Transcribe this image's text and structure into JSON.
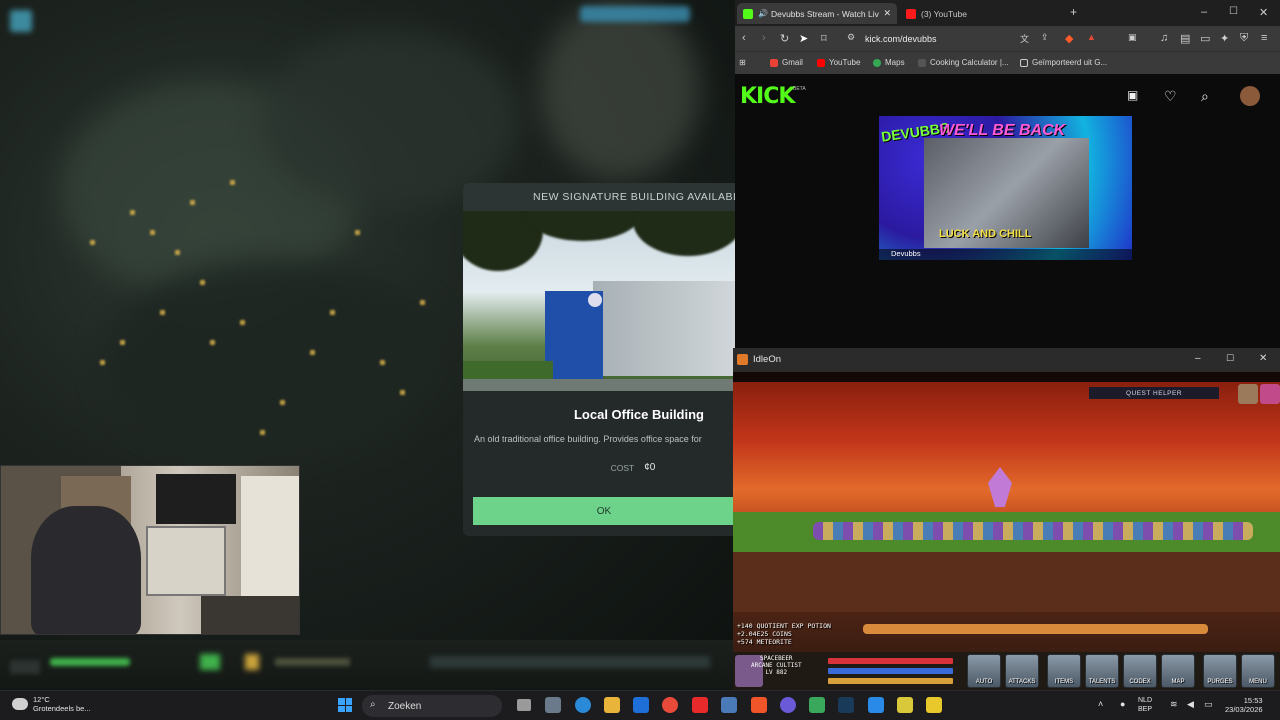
{
  "game_modal": {
    "header": "NEW SIGNATURE BUILDING AVAILABL",
    "title": "Local Office Building",
    "description": "An old traditional office building. Provides office space for",
    "cost_label": "COST",
    "cost_value": "¢0",
    "ok_label": "OK"
  },
  "browser": {
    "tabs": [
      {
        "label": "Devubbs Stream - Watch Live",
        "close": "✕"
      },
      {
        "label": "(3) YouTube"
      }
    ],
    "new_tab": "+",
    "window_controls": {
      "minimize": "–",
      "maximize": "☐",
      "close": "✕"
    },
    "address": "kick.com/devubbs",
    "bookmarks": [
      "Gmail",
      "YouTube",
      "Maps",
      "Cooking Calculator |...",
      "Geïmporteerd uit G..."
    ],
    "colors": {
      "kick_green": "#53fc18"
    }
  },
  "kick": {
    "logo": "KICK",
    "beta": "BETA",
    "thumbnail": {
      "brand": "DEVUBBS",
      "headline": "WE'LL BE BACK",
      "tagline": "LUCK AND CHILL",
      "caption": "Devubbs"
    }
  },
  "idleon": {
    "title": "IdleOn",
    "quest_helper": "QUEST HELPER",
    "stats": [
      "+140 QUOTIENT EXP POTION",
      "+2.04E25 COINS",
      "+574 METEORITE"
    ],
    "character": {
      "class": "SPACEBEER",
      "subclass": "ARCANE CULTIST",
      "level": "LV 882"
    },
    "buttons": [
      "AUTO",
      "ATTACKS",
      "ITEMS",
      "TALENTS",
      "CODEX",
      "MAP",
      "PURGES",
      "MENU"
    ]
  },
  "taskbar": {
    "weather_temp": "12°C",
    "weather_desc": "Grotendeels be...",
    "search_placeholder": "Zoeken",
    "lang_line1": "NLD",
    "lang_line2": "BEP",
    "time": "15:53",
    "date": "23/03/2026"
  }
}
